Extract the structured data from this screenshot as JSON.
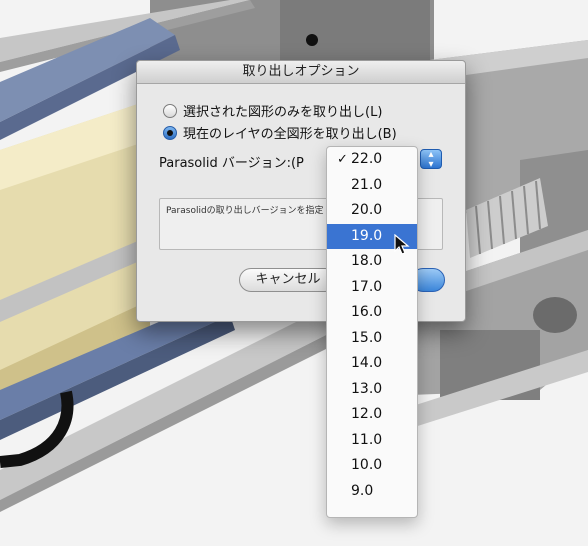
{
  "dialog": {
    "title": "取り出しオプション",
    "radio_options": [
      {
        "label": "選択された図形のみを取り出し(L)",
        "selected": false
      },
      {
        "label": "現在のレイヤの全図形を取り出し(B)",
        "selected": true
      }
    ],
    "version_label": "Parasolid バージョン:(P",
    "description": "Parasolidの取り出しバージョンを指定",
    "cancel_label": "キャンセル",
    "ok_label": ""
  },
  "version_menu": {
    "checked": "22.0",
    "highlighted": "19.0",
    "items": [
      "22.0",
      "21.0",
      "20.0",
      "19.0",
      "18.0",
      "17.0",
      "16.0",
      "15.0",
      "14.0",
      "13.0",
      "12.0",
      "11.0",
      "10.0",
      "9.0"
    ]
  },
  "colors": {
    "highlight": "#3a74d2",
    "radio_active": "#2e6fc4"
  }
}
